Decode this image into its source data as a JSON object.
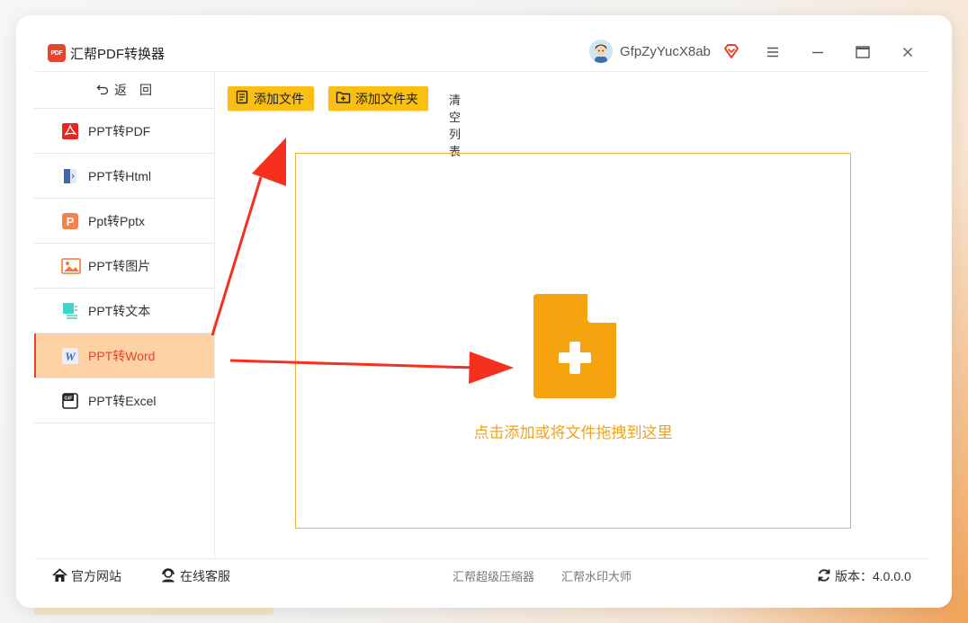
{
  "app": {
    "title": "汇帮PDF转换器",
    "logo_text": "PDF",
    "username": "GfpZyYucX8ab"
  },
  "sidebar": {
    "back_label": "返　回",
    "items": [
      {
        "label": "PPT转PDF",
        "icon": "pdf-icon",
        "active": false
      },
      {
        "label": "PPT转Html",
        "icon": "html-icon",
        "active": false
      },
      {
        "label": "Ppt转Pptx",
        "icon": "pptx-icon",
        "active": false
      },
      {
        "label": "PPT转图片",
        "icon": "image-icon",
        "active": false
      },
      {
        "label": "PPT转文本",
        "icon": "text-icon",
        "active": false
      },
      {
        "label": "PPT转Word",
        "icon": "word-icon",
        "active": true
      },
      {
        "label": "PPT转Excel",
        "icon": "excel-icon",
        "active": false
      }
    ]
  },
  "toolbar": {
    "add_file_label": "添加文件",
    "add_folder_label": "添加文件夹",
    "clear_list_label": "清空列表"
  },
  "dropzone": {
    "hint": "点击添加或将文件拖拽到这里"
  },
  "footer": {
    "website_label": "官方网站",
    "service_label": "在线客服",
    "compressor_label": "汇帮超级压缩器",
    "watermark_label": "汇帮水印大师",
    "version_label": "版本：4.0.0.0"
  },
  "colors": {
    "accent": "#fbbf14",
    "active_bg": "#fdd1a4",
    "active_text": "#e8432c",
    "dropzone_border": "#f0b23c",
    "hint_text": "#f0a21c",
    "arrow": "#f5301f"
  }
}
